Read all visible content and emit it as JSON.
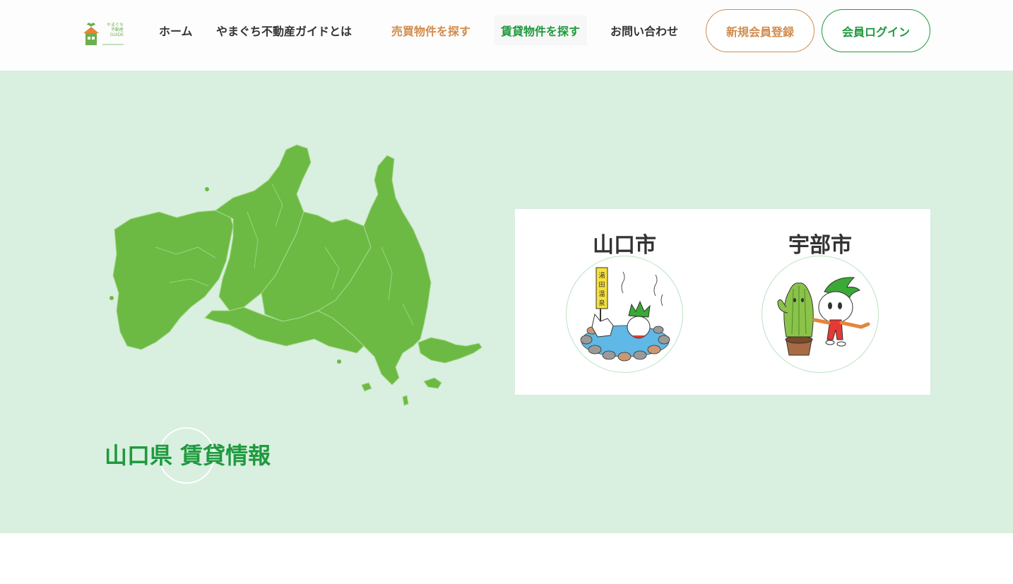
{
  "header": {
    "logo_text": "やまぐち 不動産 GUIDE",
    "nav": {
      "home": "ホーム",
      "about": "やまぐち不動産ガイドとは",
      "buy": "売買物件を探す",
      "rent": "賃貸物件を探す",
      "contact": "お問い合わせ"
    },
    "register_label": "新規会員登録",
    "login_label": "会員ログイン"
  },
  "hero": {
    "title": "山口県 賃貸情報",
    "cities": [
      {
        "name": "山口市",
        "illustration": "yuda-onsen-mascots",
        "sign_text": "湯田温泉"
      },
      {
        "name": "宇部市",
        "illustration": "cactus-mascots"
      }
    ]
  },
  "colors": {
    "accent_green": "#1f9a3e",
    "accent_orange": "#d18c4c",
    "hero_bg": "#d9efe0",
    "map_green": "#6cba44"
  }
}
